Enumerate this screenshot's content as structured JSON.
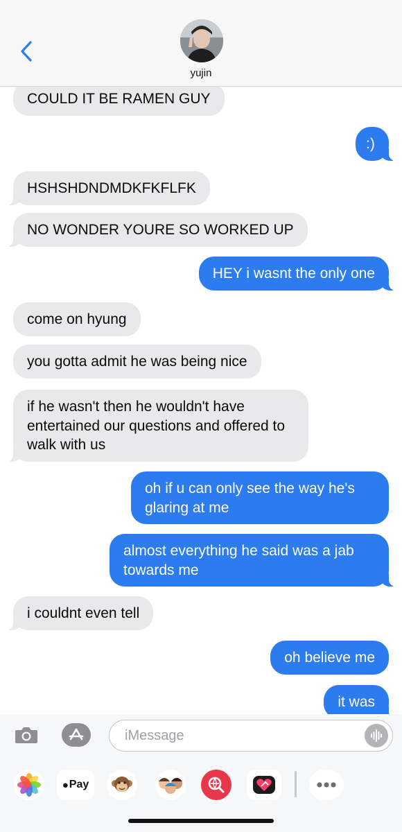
{
  "header": {
    "contact_name": "yujin",
    "back_icon": "chevron-left-icon",
    "accent": "#2c7cf0"
  },
  "messages": [
    {
      "dir": "in",
      "text": "COULD IT BE RAMEN GUY"
    },
    {
      "dir": "out",
      "text": ":)"
    },
    {
      "dir": "in",
      "text": "HSHSHDNDMDKFKFLFK"
    },
    {
      "dir": "in",
      "text": "NO WONDER YOURE SO WORKED UP"
    },
    {
      "dir": "out",
      "text": "HEY i wasnt the only one"
    },
    {
      "dir": "in",
      "text": "come on hyung"
    },
    {
      "dir": "in",
      "text": "you gotta admit he was being nice"
    },
    {
      "dir": "in",
      "text": "if he wasn't then he wouldn't have entertained our questions and offered to walk with us"
    },
    {
      "dir": "out",
      "text": "oh if u can only see the way he's glaring at me"
    },
    {
      "dir": "out",
      "text": "almost everything he said was a jab towards me"
    },
    {
      "dir": "in",
      "text": "i couldnt even tell"
    },
    {
      "dir": "out",
      "text": "oh believe me"
    },
    {
      "dir": "out",
      "text": "it was"
    }
  ],
  "composer": {
    "placeholder": "iMessage",
    "camera_icon": "camera-icon",
    "appstore_icon": "app-store-icon",
    "mic_icon": "audio-waveform-icon"
  },
  "app_drawer": {
    "apps": [
      {
        "name": "photos",
        "icon": "photos-icon"
      },
      {
        "name": "apple-pay",
        "label": "Pay"
      },
      {
        "name": "animoji",
        "icon": "monkey-icon"
      },
      {
        "name": "memoji",
        "icon": "memoji-icon"
      },
      {
        "name": "search-images",
        "icon": "globe-search-icon"
      },
      {
        "name": "digital-touch",
        "icon": "heart-touch-icon"
      },
      {
        "name": "more",
        "icon": "more-icon"
      }
    ]
  },
  "colors": {
    "incoming_bubble": "#e9e9eb",
    "outgoing_bubble": "#2c7cf0"
  }
}
